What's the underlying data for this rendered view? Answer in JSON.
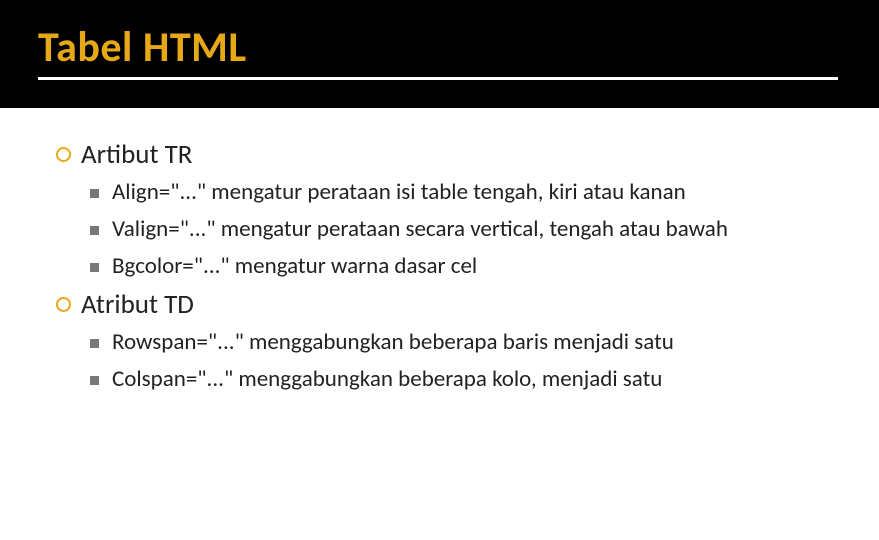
{
  "slide": {
    "title": "Tabel HTML",
    "sections": [
      {
        "heading": "Artibut TR",
        "items": [
          "Align=\"...\" mengatur perataan isi table tengah, kiri atau kanan",
          "Valign=\"...\" mengatur perataan secara vertical, tengah atau bawah",
          "Bgcolor=\"...\" mengatur warna dasar cel"
        ]
      },
      {
        "heading": "Atribut TD",
        "items": [
          "Rowspan=\"...\" menggabungkan beberapa baris menjadi satu",
          "Colspan=\"...\" menggabungkan beberapa kolo, menjadi satu"
        ]
      }
    ]
  }
}
